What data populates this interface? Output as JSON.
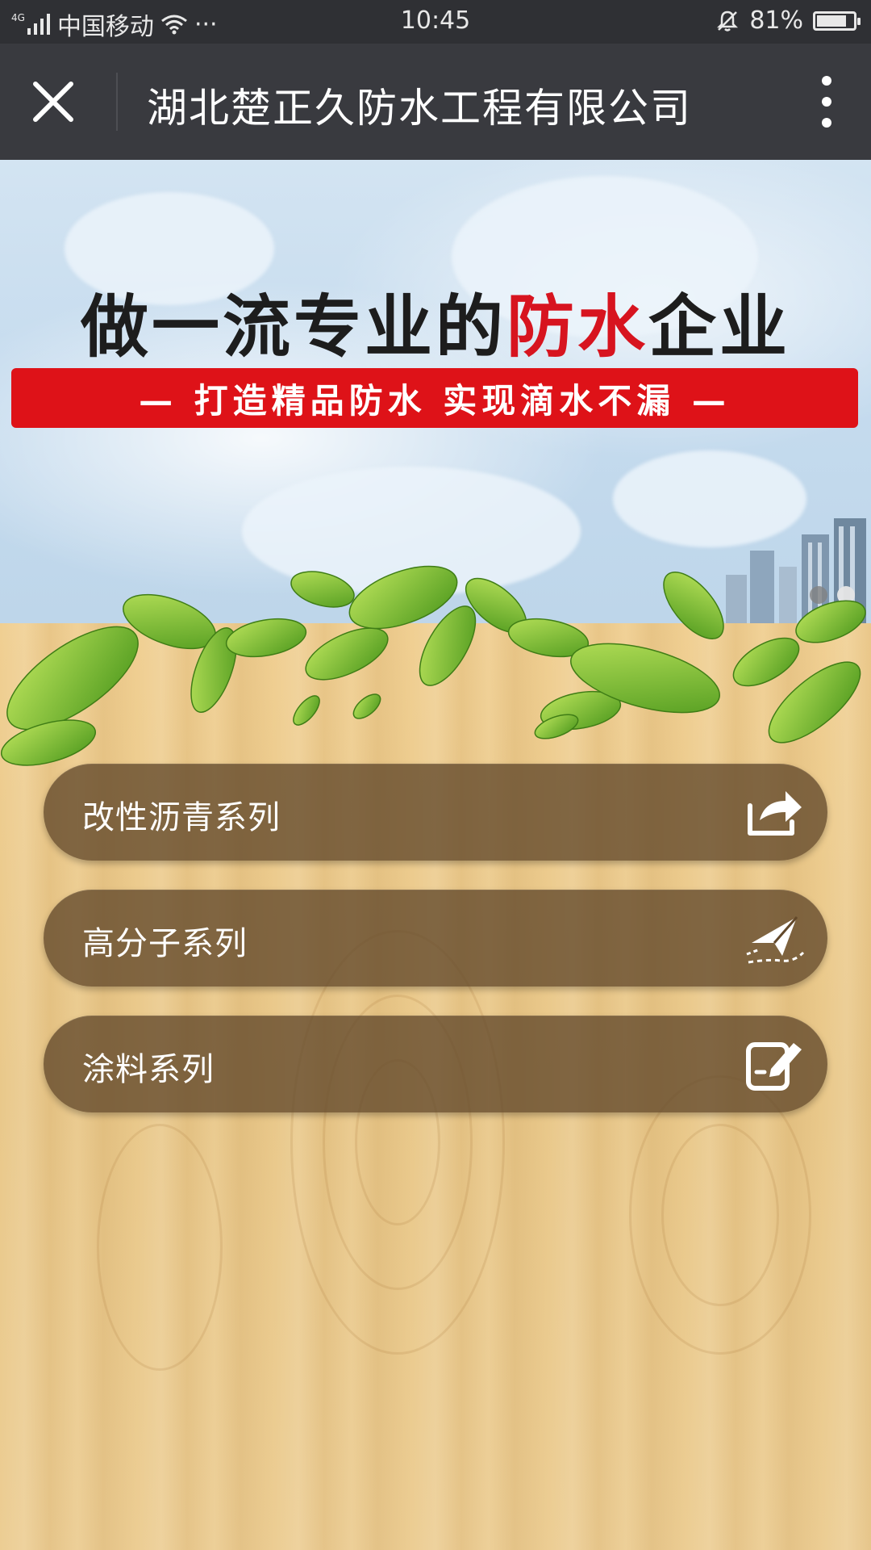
{
  "status_bar": {
    "network": "4G",
    "carrier": "中国移动",
    "more": "···",
    "time": "10:45",
    "battery": "81%",
    "battery_level": 0.81
  },
  "title_bar": {
    "title": "湖北楚正久防水工程有限公司"
  },
  "banner": {
    "headline_part1": "做一流专业的",
    "headline_accent": "防水",
    "headline_part2": "企业",
    "tagline": "— 打造精品防水  实现滴水不漏 —",
    "slide_count": 2,
    "active_slide": 2
  },
  "menu": {
    "items": [
      {
        "label": "改性沥青系列",
        "icon": "share-icon"
      },
      {
        "label": "高分子系列",
        "icon": "paper-plane-icon"
      },
      {
        "label": "涂料系列",
        "icon": "edit-icon"
      }
    ]
  },
  "colors": {
    "status_bar_bg": "#2f3034",
    "title_bar_bg": "#393a3f",
    "banner_accent": "#d7141f",
    "button_bg": "#62482a",
    "wood": "#e9c88a"
  }
}
